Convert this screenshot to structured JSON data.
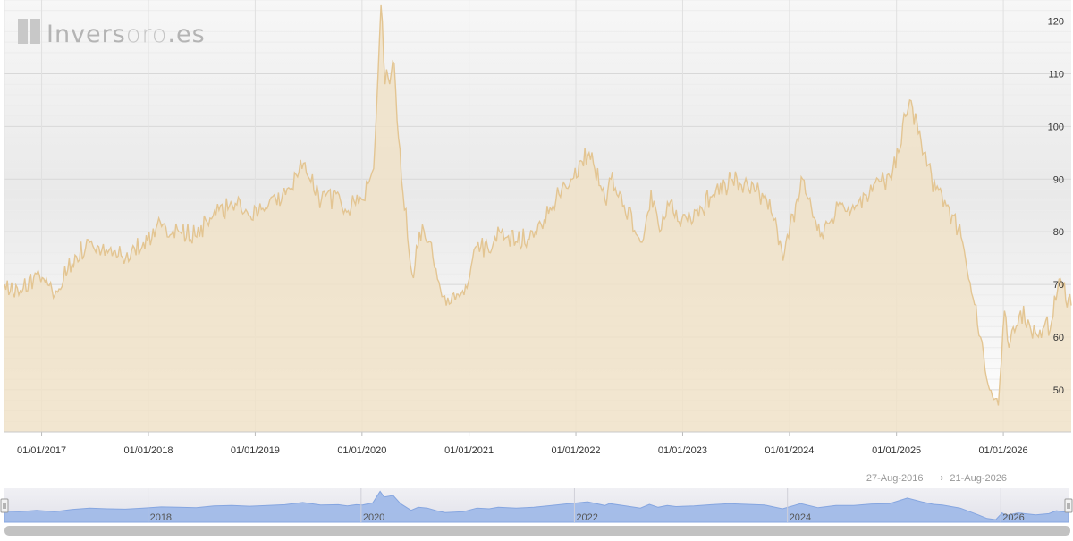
{
  "brand": {
    "name_part1": "Invers",
    "name_part2": "oro",
    "name_part3": ".es"
  },
  "range": {
    "from": "27-Aug-2016",
    "arrow": "⟶",
    "to": "21-Aug-2026"
  },
  "navigator": {
    "labels": [
      "2018",
      "2020",
      "2022",
      "2024",
      "2026"
    ]
  },
  "colors": {
    "line": "#e3c592",
    "fill": "#f0e2c8",
    "nav_fill": "#9db8e8",
    "grid": "#dddddd",
    "bg_top": "#f6f6f6",
    "bg_bottom": "#ffffff"
  },
  "chart_data": {
    "type": "area",
    "title": "",
    "xlabel": "",
    "ylabel": "",
    "xlim": [
      "2016-08-27",
      "2026-08-21"
    ],
    "ylim": [
      42,
      124
    ],
    "yticks": [
      50,
      60,
      70,
      80,
      90,
      100,
      110,
      120
    ],
    "xtick_labels": [
      "01/01/2017",
      "01/01/2018",
      "01/01/2019",
      "01/01/2020",
      "01/01/2021",
      "01/01/2022",
      "01/01/2023",
      "01/01/2024",
      "01/01/2025",
      "01/01/2026"
    ],
    "grid": true,
    "legend": "none",
    "series": [
      {
        "x": [
          "2016-08-27",
          "2016-10-15",
          "2016-12-15",
          "2017-02-15",
          "2017-04-15",
          "2017-06-15",
          "2017-08-15",
          "2017-10-15",
          "2017-12-15",
          "2018-02-15",
          "2018-04-15",
          "2018-06-15",
          "2018-08-15",
          "2018-10-15",
          "2018-12-15",
          "2019-02-15",
          "2019-04-15",
          "2019-06-15",
          "2019-08-15",
          "2019-10-15",
          "2019-11-15",
          "2019-12-15",
          "2020-01-06",
          "2020-02-10",
          "2020-03-06",
          "2020-03-20",
          "2020-04-20",
          "2020-05-15",
          "2020-06-20",
          "2020-07-15",
          "2020-08-15",
          "2020-09-15",
          "2020-10-15",
          "2020-11-15",
          "2020-12-15",
          "2021-02-01",
          "2021-03-15",
          "2021-04-15",
          "2021-06-15",
          "2021-08-15",
          "2021-10-15",
          "2021-12-15",
          "2022-02-15",
          "2022-04-15",
          "2022-05-01",
          "2022-06-15",
          "2022-08-15",
          "2022-09-15",
          "2022-10-15",
          "2022-11-15",
          "2022-12-15",
          "2023-02-15",
          "2023-04-15",
          "2023-06-15",
          "2023-08-15",
          "2023-10-15",
          "2023-12-15",
          "2024-02-15",
          "2024-04-15",
          "2024-06-15",
          "2024-08-15",
          "2024-10-15",
          "2024-12-15",
          "2025-02-15",
          "2025-04-05",
          "2025-05-15",
          "2025-06-15",
          "2025-08-15",
          "2025-10-15",
          "2025-11-15",
          "2025-12-15",
          "2026-01-05",
          "2026-01-20",
          "2026-03-01",
          "2026-05-01",
          "2026-06-15",
          "2026-07-10",
          "2026-08-21"
        ],
        "y": [
          70,
          68,
          72,
          68,
          74,
          78,
          76,
          75,
          78,
          81,
          80,
          79,
          84,
          85,
          83,
          85,
          87,
          93,
          86,
          87,
          84,
          87,
          86,
          92,
          123,
          108,
          112,
          90,
          72,
          80,
          78,
          71,
          66,
          67,
          68,
          78,
          76,
          80,
          78,
          80,
          85,
          90,
          95,
          85,
          90,
          85,
          78,
          88,
          80,
          85,
          82,
          84,
          87,
          90,
          88,
          86,
          76,
          90,
          79,
          85,
          85,
          89,
          90,
          105,
          95,
          88,
          86,
          78,
          60,
          50,
          47,
          65,
          58,
          65,
          60,
          63,
          71,
          66
        ]
      }
    ]
  }
}
